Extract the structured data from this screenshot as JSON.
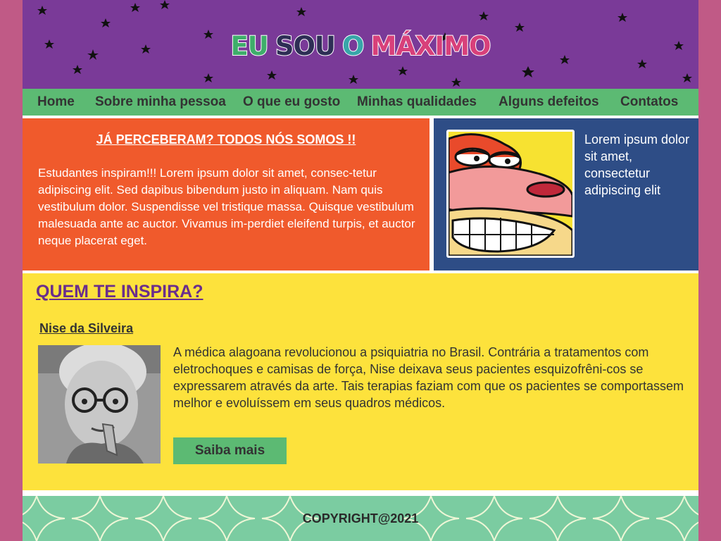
{
  "header": {
    "logo_words": [
      "EU",
      "SOU",
      "O",
      "MÁXIMO"
    ]
  },
  "nav": {
    "items": [
      {
        "label": "Home"
      },
      {
        "label": "Sobre minha pessoa"
      },
      {
        "label": "O que eu gosto"
      },
      {
        "label": "Minhas qualidades"
      },
      {
        "label": "Alguns defeitos"
      },
      {
        "label": "Contatos"
      }
    ]
  },
  "intro": {
    "heading": "JÁ PERCEBERAM? TODOS NÓS SOMOS !! ",
    "body": "Estudantes inspiram!!! Lorem ipsum dolor sit amet, consec-tetur adipiscing elit. Sed dapibus bibendum justo in aliquam. Nam quis vestibulum dolor. Suspendisse vel tristique massa. Quisque vestibulum malesuada ante ac auctor. Vivamus im-perdiet eleifend turpis, et auctor neque placerat eget."
  },
  "side": {
    "avatar_icon": "cartoon-grin-icon",
    "text": "Lorem ipsum dolor sit amet, consectetur adipiscing elit"
  },
  "inspire": {
    "heading": "QUEM TE INSPIRA?",
    "person_name": "Nise da Silveira",
    "description": "A médica alagoana revolucionou a psiquiatria no Brasil. Contrária a tratamentos com eletrochoques e camisas de força, Nise deixava seus pacientes esquizofrêni-cos se expressarem através da arte. Tais terapias faziam com que os pacientes se comportassem melhor e evoluíssem em seus quadros médicos.",
    "button_label": "Saiba mais"
  },
  "footer": {
    "copyright": "COPYRIGHT@2021"
  },
  "colors": {
    "header_bg": "#7a3a98",
    "nav_bg": "#5cba73",
    "intro_bg": "#f05a2c",
    "side_bg": "#2e4d86",
    "inspire_bg": "#fde23c",
    "footer_bg": "#7bcca1",
    "page_bg": "#c05a86"
  }
}
